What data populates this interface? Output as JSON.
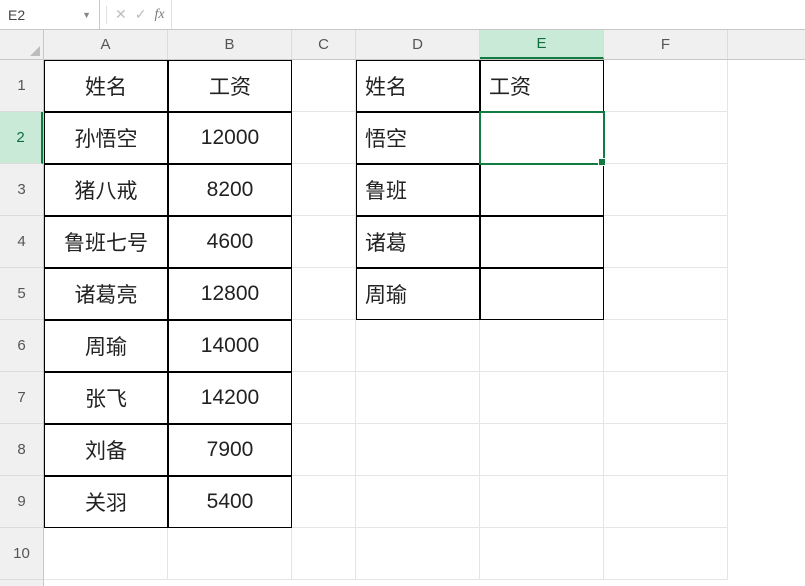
{
  "formula_bar": {
    "cell_ref": "E2",
    "cancel_glyph": "✕",
    "confirm_glyph": "✓",
    "fx_label": "fx",
    "formula_value": ""
  },
  "columns": [
    "A",
    "B",
    "C",
    "D",
    "E",
    "F"
  ],
  "column_widths": {
    "C": "narrow"
  },
  "rows": [
    "1",
    "2",
    "3",
    "4",
    "5",
    "6",
    "7",
    "8",
    "9",
    "10"
  ],
  "active_col": "E",
  "active_row": "2",
  "accent_color": "#107c41",
  "table1": {
    "header": {
      "name": "姓名",
      "salary": "工资"
    },
    "rows": [
      {
        "name": "孙悟空",
        "salary": "12000"
      },
      {
        "name": "猪八戒",
        "salary": "8200"
      },
      {
        "name": "鲁班七号",
        "salary": "4600"
      },
      {
        "name": "诸葛亮",
        "salary": "12800"
      },
      {
        "name": "周瑜",
        "salary": "14000"
      },
      {
        "name": "张飞",
        "salary": "14200"
      },
      {
        "name": "刘备",
        "salary": "7900"
      },
      {
        "name": "关羽",
        "salary": "5400"
      }
    ]
  },
  "table2": {
    "header": {
      "name": "姓名",
      "salary": "工资"
    },
    "rows": [
      {
        "name": "悟空",
        "salary": ""
      },
      {
        "name": "鲁班",
        "salary": ""
      },
      {
        "name": "诸葛",
        "salary": ""
      },
      {
        "name": "周瑜",
        "salary": ""
      }
    ]
  }
}
